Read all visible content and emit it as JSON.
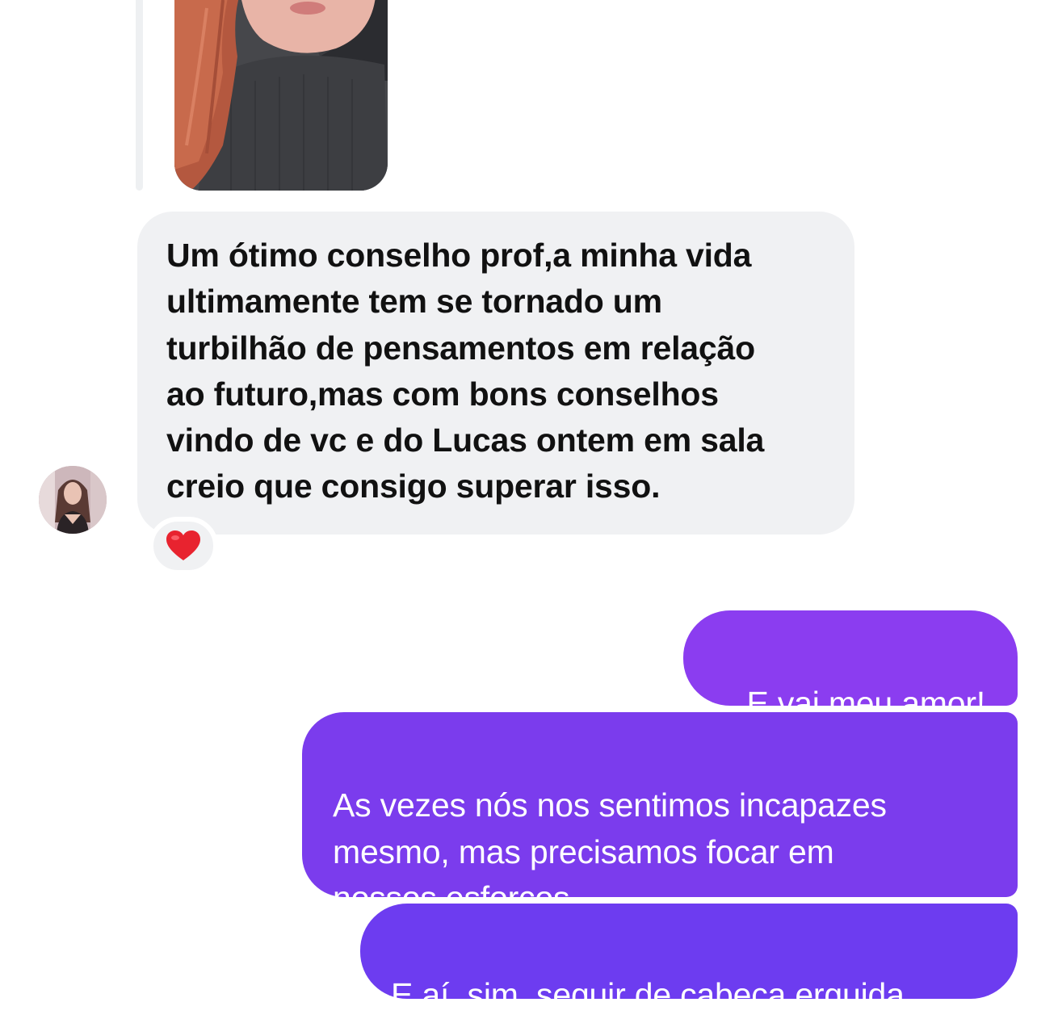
{
  "conversation": {
    "incoming": {
      "photo_icon": "shared-photo",
      "message": "Um ótimo conselho prof,a minha vida\nultimamente tem se tornado um\nturbilhão de pensamentos em relação\nao futuro,mas com bons conselhos\nvindo de vc e do Lucas ontem em sala\ncreio que consigo superar isso.",
      "reaction": "❤️"
    },
    "outgoing": [
      {
        "message": "E vai meu amor!"
      },
      {
        "message": "As vezes nós nos sentimos incapazes\nmesmo, mas precisamos focar em\nnossos esforços"
      },
      {
        "message": "E aí, sim, seguir de cabeça erguida"
      }
    ]
  },
  "colors": {
    "incoming_bubble": "#f0f1f3",
    "outgoing_bubble_top": "#8b3df0",
    "outgoing_bubble_bottom": "#6d3cf0",
    "text_dark": "#111111",
    "text_light": "#ffffff"
  }
}
